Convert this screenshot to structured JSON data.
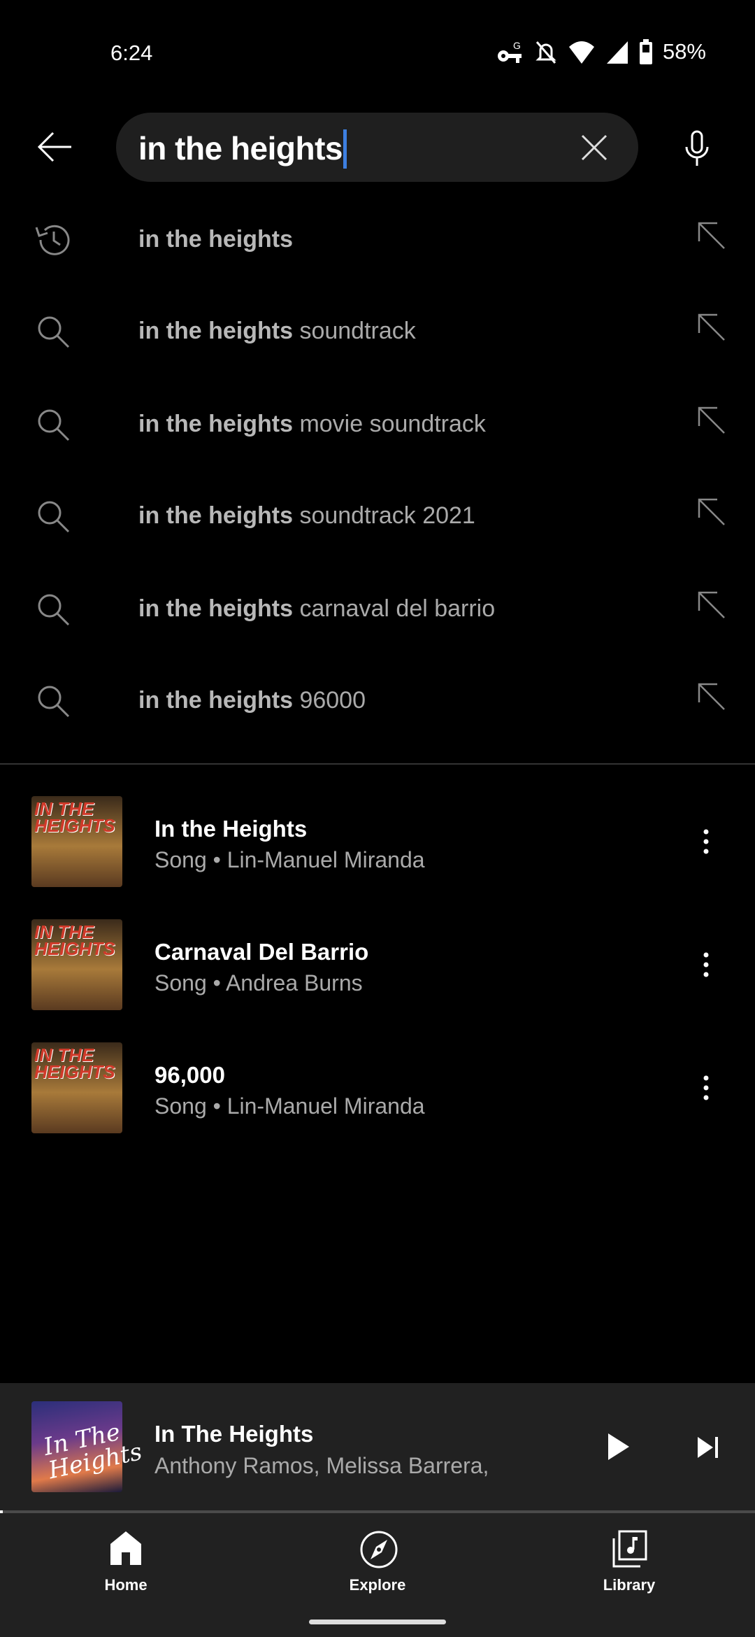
{
  "status_bar": {
    "time": "6:24",
    "battery": "58%",
    "icons": [
      "vpn-key-icon",
      "bell-off-icon",
      "wifi-icon",
      "signal-icon",
      "battery-icon"
    ]
  },
  "search": {
    "query": "in the heights"
  },
  "suggestions": [
    {
      "type": "history",
      "bold": "in the heights",
      "rest": ""
    },
    {
      "type": "search",
      "bold": "in the heights",
      "rest": " soundtrack"
    },
    {
      "type": "search",
      "bold": "in the heights",
      "rest": " movie soundtrack"
    },
    {
      "type": "search",
      "bold": "in the heights",
      "rest": " soundtrack 2021"
    },
    {
      "type": "search",
      "bold": "in the heights",
      "rest": " carnaval del barrio"
    },
    {
      "type": "search",
      "bold": "in the heights",
      "rest": " 96000"
    }
  ],
  "songs": [
    {
      "title": "In the Heights",
      "subtitle": "Song • Lin-Manuel Miranda",
      "art_text": "IN THE HEIGHTS"
    },
    {
      "title": "Carnaval Del Barrio",
      "subtitle": "Song • Andrea Burns",
      "art_text": "IN THE HEIGHTS"
    },
    {
      "title": "96,000",
      "subtitle": "Song • Lin-Manuel Miranda",
      "art_text": "IN THE HEIGHTS"
    }
  ],
  "mini_player": {
    "title": "In The Heights",
    "artists": "Anthony Ramos, Melissa Barrera,",
    "art_text": "In The Heights",
    "progress": 0.004
  },
  "nav": [
    {
      "label": "Home"
    },
    {
      "label": "Explore"
    },
    {
      "label": "Library"
    }
  ],
  "colors": {
    "accent_caret": "#3d7fe0",
    "background": "#000000",
    "panel": "#212121"
  }
}
